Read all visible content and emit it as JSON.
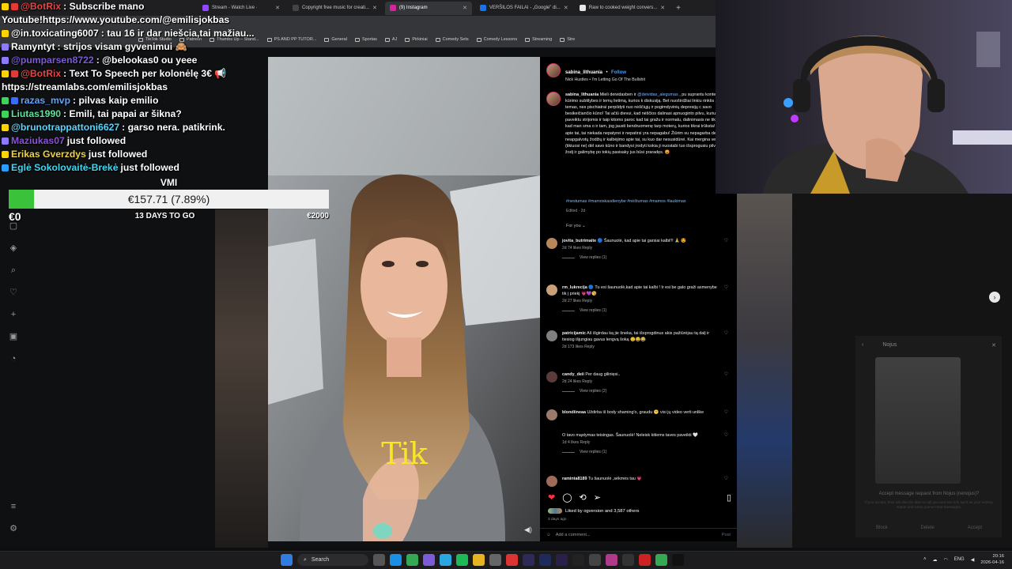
{
  "browser": {
    "tabs": [
      {
        "label": "Stream - Watch Live ·",
        "color": "#9146ff",
        "active": false
      },
      {
        "label": "Copyright free music for creati...",
        "color": "#444",
        "active": false
      },
      {
        "label": "(9) Instagram",
        "color": "#d6249f",
        "active": true
      },
      {
        "label": "VERŠILOS FAILAI - „Google\" di...",
        "color": "#1a73e8",
        "active": false
      },
      {
        "label": "Raw to cooked weight convers...",
        "color": "#e6e6e6",
        "active": false
      }
    ],
    "new_tab": "+",
    "bookmarks": [
      "TikTok Studio",
      "Patreon",
      "Thumbs Up – Stand...",
      "PS AND PP TUTOR...",
      "General",
      "Sportas",
      "AJ",
      "Pirkiniai",
      "Comedy Sets",
      "Comedy Lessons",
      "Streaming",
      "Stre"
    ]
  },
  "chat": [
    {
      "user": "@BotRix",
      "user_color": "#e64545",
      "badges": [
        "#ffd400",
        "#e53935"
      ],
      "msg": ": Subscribe mano"
    },
    {
      "user": "",
      "user_color": "#fff",
      "badges": [],
      "msg": "Youtube!https://www.youtube.com/@emilisjokbas"
    },
    {
      "user": "@in.toxicating6007",
      "user_color": "#fff",
      "badges": [
        "#ffd400"
      ],
      "msg": ": tau 16 ir dar niešcia,tai mažiau..."
    },
    {
      "user": "Ramyntyt",
      "user_color": "#fff",
      "badges": [
        "#8d7bff"
      ],
      "msg": ": strijos visam gyvenimui 🙈"
    },
    {
      "user": "@pumparsen8722",
      "user_color": "#7b5bd6",
      "badges": [
        "#8d7bff"
      ],
      "msg": ": @belookas0 ou yeee"
    },
    {
      "user": "@BotRix",
      "user_color": "#e64545",
      "badges": [
        "#ffd400",
        "#e53935"
      ],
      "msg": ": Text To Speech per kolonėlę 3€ 📢"
    },
    {
      "user": "",
      "user_color": "#fff",
      "badges": [],
      "msg": "https://streamlabs.com/emilisjokbas"
    },
    {
      "user": "razas_mvp",
      "user_color": "#5fa3ff",
      "badges": [
        "#3ed35a",
        "#3a6cff"
      ],
      "msg": ": pilvas kaip emilio"
    },
    {
      "user": "Liutas1990",
      "user_color": "#5fe09b",
      "badges": [
        "#3ed35a"
      ],
      "msg": ": Emili, tai papai ar šikna?"
    },
    {
      "user": "@brunotrappattoni6627",
      "user_color": "#53d6ff",
      "badges": [
        "#ffd400"
      ],
      "msg": ": garso nera. patikrink."
    },
    {
      "user": "Maziukas07",
      "user_color": "#8a52d8",
      "badges": [
        "#8d7bff"
      ],
      "msg": " just followed"
    },
    {
      "user": "Erikas Gverzdys",
      "user_color": "#f0d53a",
      "badges": [
        "#ffd400"
      ],
      "msg": " just followed"
    },
    {
      "user": "Eglė Sokolovaitė-Brekė",
      "user_color": "#40d6f0",
      "badges": [
        "#2b9cff"
      ],
      "msg": " just followed"
    }
  ],
  "goal": {
    "title": "VMI",
    "amount": "€157.71 (7.89%)",
    "progress": 0.0789,
    "min": "€0",
    "max": "€2000",
    "remaining": "13 DAYS TO GO",
    "accent": "#39c23a"
  },
  "post": {
    "username": "sabina_lithuania",
    "follow": "Follow",
    "audio": "Nick Hustles • I'm Letting Go Of The Bullshit",
    "caption_user": "sabina_lithuania",
    "caption_pre": " Mieli deividasben ir ",
    "caption_mention": "@deividas_alegumas",
    "caption_post": " , pu suprantu kontento kūrimo subtilybes ir temų lietimą, kurios k diskusiją. Bet nuoširdžiai linkiu rinktis atsargiau temas, nes pischiatrai perpildyti nuo nėščiųjų ir pogimdyvinių depresijų c savo besikeičiančio kūno! Tai ačiū dievui, kad nėščios dalinasi apnuoginto pilvu, kuriuos paveiktu strijomis ir taip kitoms paroc kad tai gražu ir normalu, dalinimasis ne tik tam, kad man sma o ir tam, jog jausti bendruomenę tarp moterų, kurios tikrai trūksta! Kalbėti apie tai, tai niekada nepatyrei ir nepatirsi yra nepagabu! Žiūrim su nepagarba del neapgalvotų žodžių ir kalbėjimo apie tai, su kuo dar nesusidūrei. Kai mergina verks (tikiuosi ne) dėl savo kūno ir bandysi įrodyti kokia ji nuostabi tuo išsprogusiu pilvu, savo žodį ir galimybę po tokių pasisaky jus būsi praradęs. 😡",
    "tags": "#nestumas #mamoskasdienybe #nėštumas #mamos #laukimas",
    "edited": "Edited · 2d",
    "for_you": "For you ⌄",
    "comments": [
      {
        "user": "jovita_butrimaite",
        "text": " 🔵 Šaunuolė, kad apie tai garsiai kalbi!!! 🙏 😍",
        "meta": "2d   74 likes   Reply",
        "replies": "View replies (1)"
      },
      {
        "user": "rm_lukrecija",
        "text": " 🔵 Tu esi šaunuolė,kad apie tai kalbi ! Ir esi be galo graži asmenybe tik į priekį 💗💜😘",
        "meta": "2d   27 likes   Reply",
        "replies": "View replies (1)"
      },
      {
        "user": "patricijamic",
        "text": " Aš išgirdau ką jie šneka, tai išsprogdinus akis pažiūrėjau tą dalį ir tiesiog išjungiau gavus lengvą šoką 😟😂😂",
        "meta": "2d   173 likes   Reply",
        "replies": ""
      },
      {
        "user": "candy_deii",
        "text": " Per daug gilinięsi..",
        "meta": "2d   24 likes   Reply",
        "replies": "View replies (2)"
      },
      {
        "user": "blondiineaa",
        "text": " Uždirba iš body shaming'o, graudu 😕 visi jų video verti unlike",
        "meta": "",
        "replies": ""
      },
      {
        "user": "",
        "text": "O tavo mąstymas teisingas. Šaunuolė! Neleisk kitiems taves paveikti 🤍",
        "meta": "1d   4 likes   Reply",
        "replies": "View replies (1)"
      },
      {
        "user": "raminta8189",
        "text": " Tu šaunuolė ,sėkmės tau 💗",
        "meta": "",
        "replies": ""
      }
    ],
    "liked_by": "Liked by ogversion and 3,587 others",
    "ago": "3 days ago",
    "add_comment": "Add a comment...",
    "post_btn": "Post"
  },
  "video": {
    "caption": "Tik"
  },
  "dm": {
    "title": "Nojus",
    "request": "Accept message request from Nojus (nenojus)?",
    "note": "If you accept, they will also be able to call you and see info such as your activity status and when you've read messages.",
    "block": "Block",
    "delete": "Delete",
    "accept": "Accept"
  },
  "taskbar": {
    "search": "Search",
    "lang": "ENG",
    "time": "20:16",
    "date": "2026-04-16"
  }
}
